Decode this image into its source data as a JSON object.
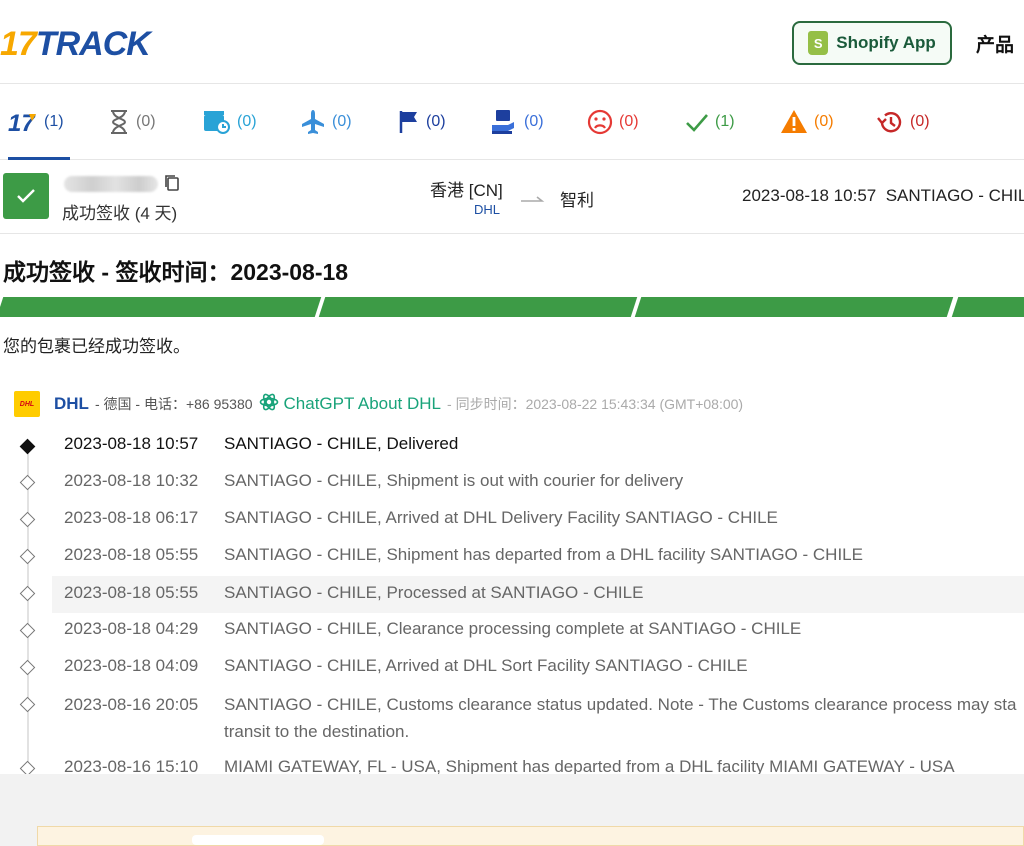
{
  "header": {
    "logo_number": "17",
    "logo_text": "TRACK",
    "shopify_label": "Shopify App",
    "shopify_bag_glyph": "S",
    "nav_products": "产品",
    "colors": {
      "brand_blue": "#1d4fa3",
      "brand_yellow": "#f7a800",
      "shopify_green": "#95bf47"
    }
  },
  "tabs": [
    {
      "icon": "17track-all-icon",
      "count": "(1)",
      "color": "#1d4fa3"
    },
    {
      "icon": "hourglass-icon",
      "count": "(0)",
      "color": "#777777"
    },
    {
      "icon": "pickup-truck-icon",
      "count": "(0)",
      "color": "#29a3d6"
    },
    {
      "icon": "airplane-icon",
      "count": "(0)",
      "color": "#3a8fd9"
    },
    {
      "icon": "flag-icon",
      "count": "(0)",
      "color": "#1d3f9e"
    },
    {
      "icon": "delivery-person-icon",
      "count": "(0)",
      "color": "#3a6fd9"
    },
    {
      "icon": "sad-face-icon",
      "count": "(0)",
      "color": "#e53935"
    },
    {
      "icon": "checkmark-icon",
      "count": "(1)",
      "color": "#3d9b46"
    },
    {
      "icon": "warning-icon",
      "count": "(0)",
      "color": "#f57c00"
    },
    {
      "icon": "history-icon",
      "count": "(0)",
      "color": "#c62828"
    }
  ],
  "summary": {
    "status": "成功签收 (4 天)",
    "origin": "香港 [CN]",
    "carrier": "DHL",
    "destination": "智利",
    "latest_time": "2023-08-18 10:57",
    "latest_location": "SANTIAGO - CHILE"
  },
  "status_title": "成功签收 - 签收时间：2023-08-18",
  "status_description": "您的包裹已经成功签收。",
  "carrier_info": {
    "logo_text": "DHL",
    "name": "DHL",
    "country": "- 德国 - 电话：+86 95380",
    "chatgpt_label": "ChatGPT About DHL",
    "sync_time": "- 同步时间：2023-08-22 15:43:34 (GMT+08:00)"
  },
  "events": [
    {
      "time": "2023-08-18 10:57",
      "desc": "SANTIAGO - CHILE, Delivered"
    },
    {
      "time": "2023-08-18 10:32",
      "desc": "SANTIAGO - CHILE, Shipment is out with courier for delivery"
    },
    {
      "time": "2023-08-18 06:17",
      "desc": "SANTIAGO - CHILE, Arrived at DHL Delivery Facility SANTIAGO - CHILE"
    },
    {
      "time": "2023-08-18 05:55",
      "desc": "SANTIAGO - CHILE, Shipment has departed from a DHL facility SANTIAGO - CHILE"
    },
    {
      "time": "2023-08-18 05:55",
      "desc": "SANTIAGO - CHILE, Processed at SANTIAGO - CHILE"
    },
    {
      "time": "2023-08-18 04:29",
      "desc": "SANTIAGO - CHILE, Clearance processing complete at SANTIAGO - CHILE"
    },
    {
      "time": "2023-08-18 04:09",
      "desc": "SANTIAGO - CHILE, Arrived at DHL Sort Facility SANTIAGO - CHILE"
    },
    {
      "time": "2023-08-16 20:05",
      "desc": "SANTIAGO - CHILE, Customs clearance status updated. Note - The Customs clearance process may sta transit to the destination."
    },
    {
      "time": "2023-08-16 15:10",
      "desc": "MIAMI GATEWAY, FL - USA, Shipment has departed from a DHL facility MIAMI GATEWAY - USA"
    }
  ]
}
